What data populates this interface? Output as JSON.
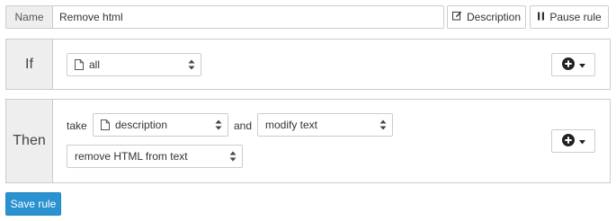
{
  "header": {
    "name_label": "Name",
    "name_value": "Remove html",
    "description_button": "Description",
    "pause_button": "Pause rule"
  },
  "if_section": {
    "label": "If",
    "field_select": "all"
  },
  "then_section": {
    "label": "Then",
    "take_word": "take",
    "field_select": "description",
    "and_word": "and",
    "action_select": "modify text",
    "operation_select": "remove HTML from text"
  },
  "footer": {
    "save_button": "Save rule"
  },
  "colors": {
    "accent": "#2a92d0",
    "panel_gray": "#eeeeee",
    "border": "#cccccc"
  },
  "icons": [
    "edit-icon",
    "pause-icon",
    "document-icon",
    "sort-arrows-icon",
    "plus-circle-icon",
    "caret-down-icon"
  ]
}
